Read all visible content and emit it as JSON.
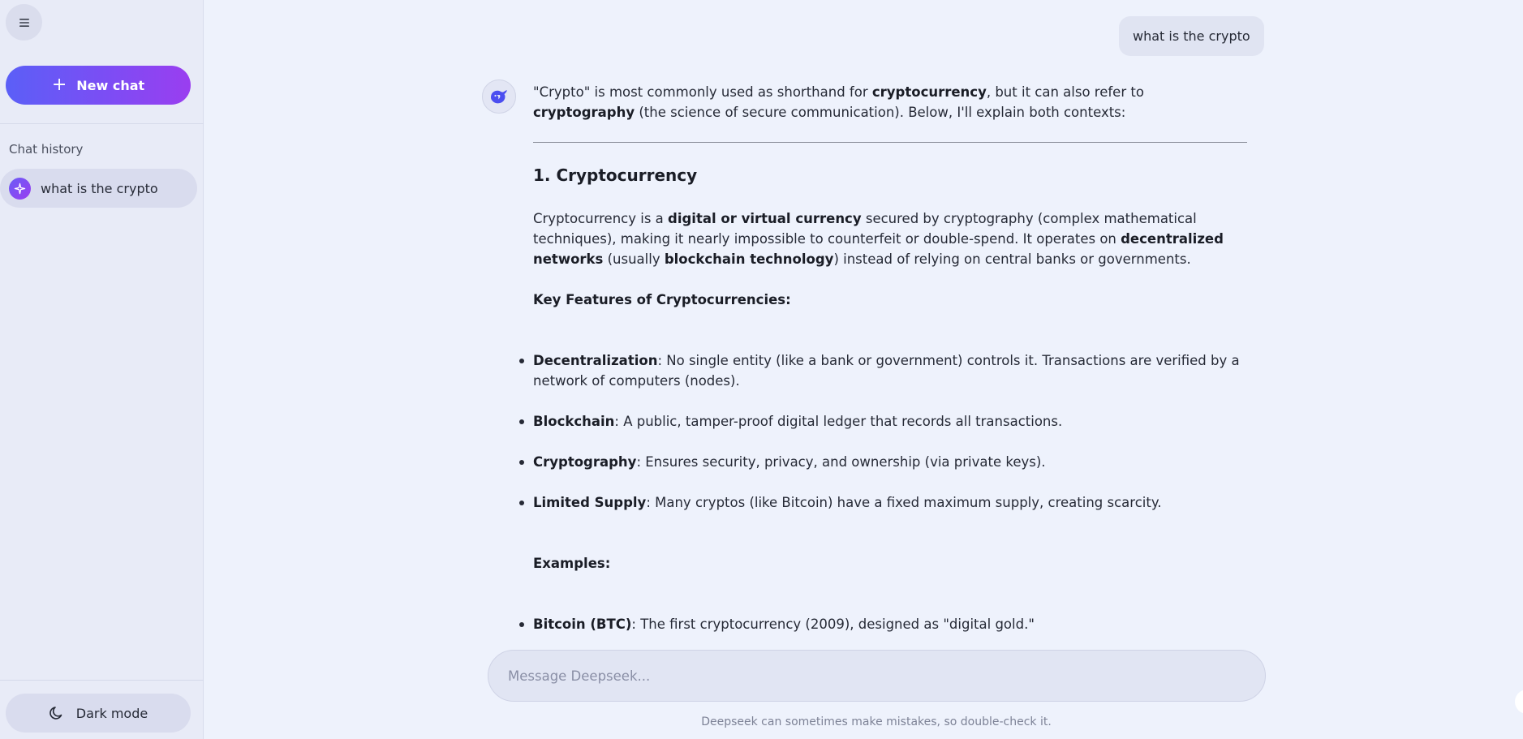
{
  "sidebar": {
    "menu_icon": "hamburger-menu-icon",
    "new_chat_label": "New chat",
    "history_title": "Chat history",
    "history": [
      {
        "label": "what is the crypto",
        "icon": "sparkle-icon"
      }
    ],
    "dark_mode_label": "Dark mode"
  },
  "chat": {
    "user_message": "what is the crypto",
    "answer": {
      "intro_1": "\"Crypto\" is most commonly used as shorthand for ",
      "intro_b1": "cryptocurrency",
      "intro_2": ", but it can also refer to ",
      "intro_b2": "cryptography",
      "intro_3": " (the science of secure communication). Below, I'll explain both contexts:",
      "section_title": "1. Cryptocurrency",
      "para_1": "Cryptocurrency is a ",
      "para_b1": "digital or virtual currency",
      "para_2": " secured by cryptography (complex mathematical techniques), making it nearly impossible to counterfeit or double-spend. It operates on ",
      "para_b2": "decentralized networks",
      "para_3": " (usually ",
      "para_b3": "blockchain technology",
      "para_4": ") instead of relying on central banks or governments.",
      "features_heading": "Key Features of Cryptocurrencies:",
      "features": [
        {
          "term": "Decentralization",
          "text": ": No single entity (like a bank or government) controls it. Transactions are verified by a network of computers (nodes)."
        },
        {
          "term": "Blockchain",
          "text": ": A public, tamper-proof digital ledger that records all transactions."
        },
        {
          "term": "Cryptography",
          "text": ": Ensures security, privacy, and ownership (via private keys)."
        },
        {
          "term": "Limited Supply",
          "text": ": Many cryptos (like Bitcoin) have a fixed maximum supply, creating scarcity."
        }
      ],
      "examples_heading": "Examples:",
      "examples": [
        {
          "term": "Bitcoin (BTC)",
          "text": ": The first cryptocurrency (2009), designed as \"digital gold.\""
        }
      ]
    }
  },
  "composer": {
    "placeholder": "Message Deepseek...",
    "disclaimer": "Deepseek can sometimes make mistakes, so double-check it."
  },
  "colors": {
    "accent_start": "#5b5ff7",
    "accent_end": "#9a3ef0",
    "background": "#eef2fc",
    "sidebar": "#e8ebf7"
  }
}
